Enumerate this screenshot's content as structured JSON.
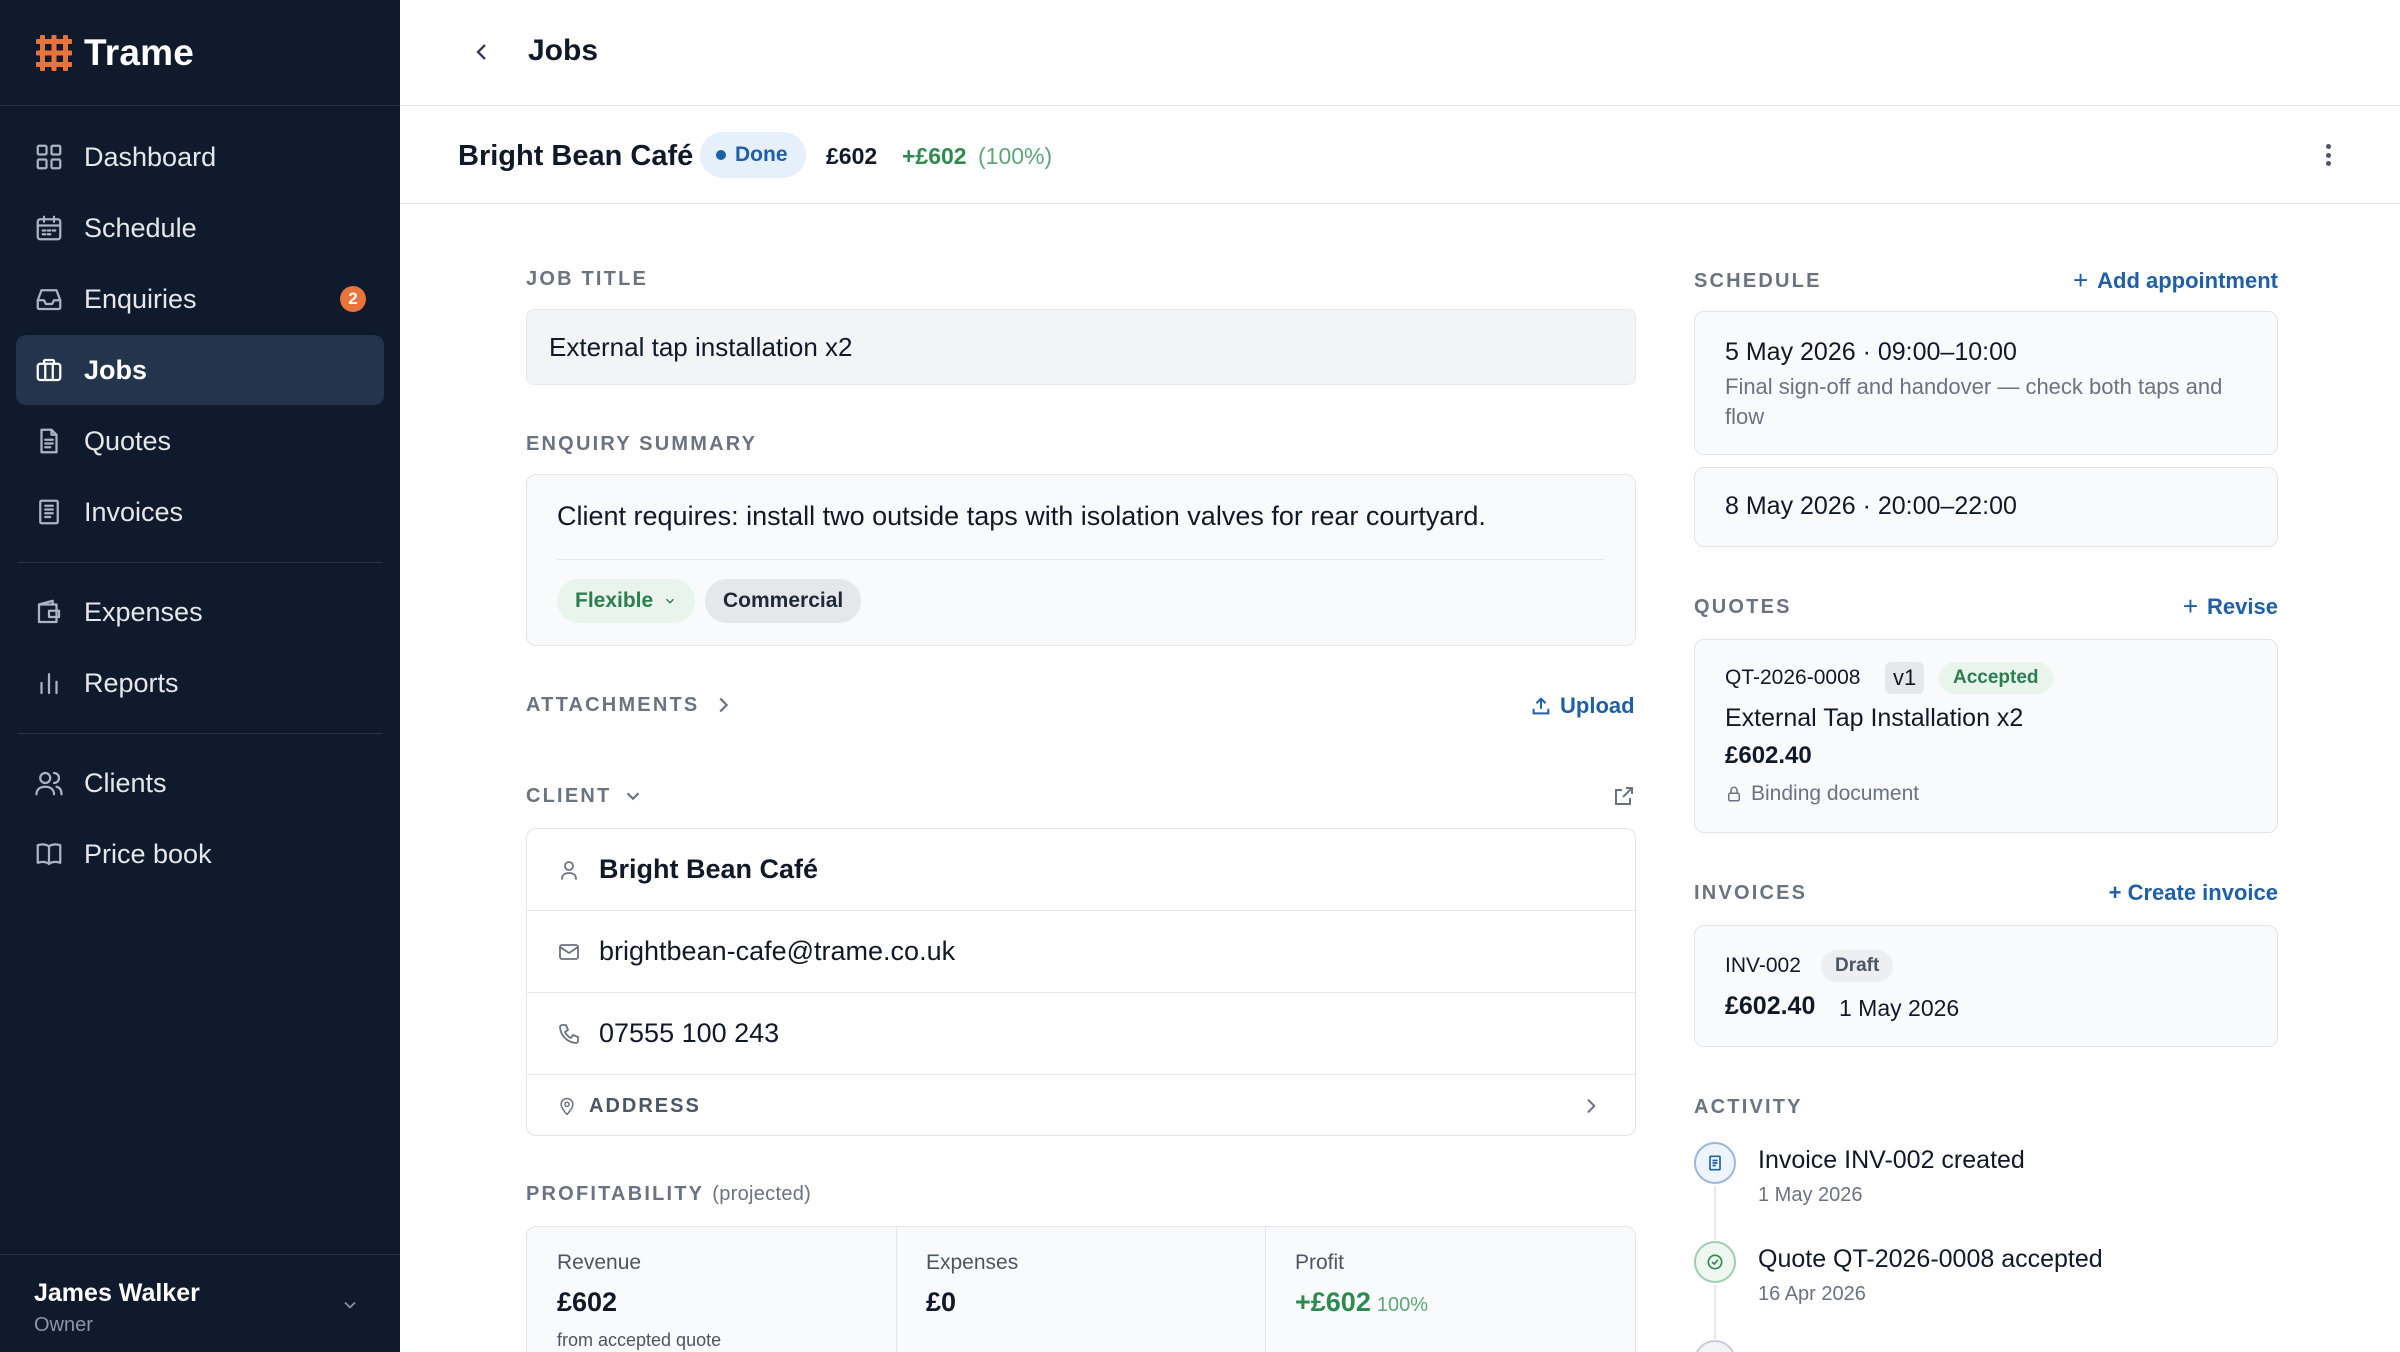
{
  "app": {
    "name": "Trame",
    "brand_color": "#e8743b"
  },
  "sidebar": {
    "items": [
      {
        "label": "Dashboard",
        "icon": "dashboard-icon"
      },
      {
        "label": "Schedule",
        "icon": "calendar-icon"
      },
      {
        "label": "Enquiries",
        "icon": "inbox-icon",
        "badge": "2"
      },
      {
        "label": "Jobs",
        "icon": "briefcase-icon",
        "active": true
      },
      {
        "label": "Quotes",
        "icon": "document-icon"
      },
      {
        "label": "Invoices",
        "icon": "receipt-icon"
      },
      {
        "label": "Expenses",
        "icon": "wallet-icon"
      },
      {
        "label": "Reports",
        "icon": "bar-chart-icon"
      },
      {
        "label": "Clients",
        "icon": "users-icon"
      },
      {
        "label": "Price book",
        "icon": "book-icon"
      }
    ],
    "user": {
      "name": "James Walker",
      "role": "Owner"
    }
  },
  "topbar": {
    "title": "Jobs"
  },
  "job": {
    "client_name": "Bright Bean Café",
    "status": "Done",
    "amount": "£602",
    "profit": "+£602",
    "profit_pct": "(100%)"
  },
  "details": {
    "job_title_label": "Job title",
    "job_title_value": "External tap installation x2",
    "enquiry_label": "Enquiry summary",
    "enquiry_text": "Client requires: install two outside taps with isolation valves for rear courtyard.",
    "tags": [
      "Flexible",
      "Commercial"
    ],
    "attachments_label": "Attachments",
    "upload_label": "Upload",
    "client_label": "Client",
    "client": {
      "name": "Bright Bean Café",
      "email": "brightbean-cafe@trame.co.uk",
      "phone": "07555 100 243",
      "address_label": "Address"
    },
    "profitability_label": "Profitability",
    "profitability_sub": "(projected)",
    "profitability": {
      "revenue_label": "Revenue",
      "revenue_value": "£602",
      "revenue_note": "from accepted quote",
      "expenses_label": "Expenses",
      "expenses_value": "£0",
      "profit_label": "Profit",
      "profit_value": "+£602",
      "profit_pct": "100%"
    }
  },
  "schedule": {
    "label": "Schedule",
    "action": "Add appointment",
    "appointments": [
      {
        "title": "5 May 2026 · 09:00–10:00",
        "note": "Final sign-off and handover — check both taps and flow"
      },
      {
        "title": "8 May 2026 · 20:00–22:00"
      }
    ]
  },
  "quotes": {
    "label": "Quotes",
    "action": "Revise",
    "item": {
      "number": "QT-2026-0008",
      "version": "v1",
      "status": "Accepted",
      "title": "External Tap Installation x2",
      "amount": "£602.40",
      "note": "Binding document"
    }
  },
  "invoices": {
    "label": "Invoices",
    "action": "+ Create invoice",
    "item": {
      "number": "INV-002",
      "status": "Draft",
      "amount": "£602.40",
      "date": "1 May 2026"
    }
  },
  "activity": {
    "label": "Activity",
    "items": [
      {
        "title": "Invoice INV-002 created",
        "date": "1 May 2026"
      },
      {
        "title": "Quote QT-2026-0008 accepted",
        "date": "16 Apr 2026"
      }
    ]
  }
}
